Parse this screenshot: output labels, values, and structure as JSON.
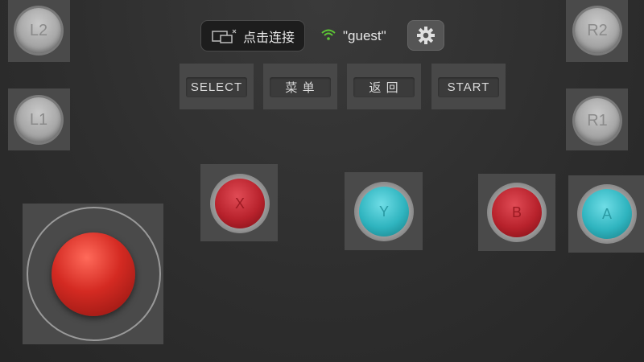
{
  "shoulders": {
    "l2": "L2",
    "l1": "L1",
    "r2": "R2",
    "r1": "R1"
  },
  "topbar": {
    "connect_label": "点击连接",
    "wifi_name": "\"guest\""
  },
  "menu": {
    "select": "SELECT",
    "menu": "菜 单",
    "back": "返 回",
    "start": "START"
  },
  "actions": {
    "x": "X",
    "y": "Y",
    "b": "B",
    "a": "A"
  },
  "colors": {
    "accent_red": "#c22a33",
    "accent_cyan": "#35b8c2",
    "wifi_green": "#5dc735"
  },
  "icons": [
    "screen-cast-icon",
    "wifi-icon",
    "gear-icon"
  ]
}
